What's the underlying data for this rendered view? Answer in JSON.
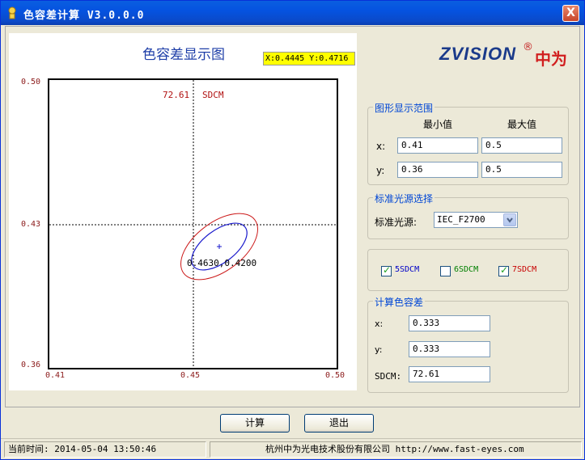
{
  "window": {
    "title": "色容差计算 V3.0.0.0",
    "close_glyph": "X"
  },
  "graph": {
    "title": "色容差显示图",
    "coord_readout": "X:0.4445 Y:0.4716",
    "sdcm_value_label": "72.61",
    "sdcm_unit_label": "SDCM",
    "center_label": "0.4630,0.4200",
    "y_ticks": [
      "0.50",
      "0.43",
      "0.36"
    ],
    "x_ticks": [
      "0.41",
      "0.45",
      "0.50"
    ]
  },
  "logo": {
    "text": "ZVISION",
    "registered": "®",
    "cn_text": "中为"
  },
  "range_group": {
    "title": "图形显示范围",
    "min_header": "最小值",
    "max_header": "最大值",
    "x_label": "x:",
    "y_label": "y:",
    "x_min": "0.41",
    "x_max": "0.5",
    "y_min": "0.36",
    "y_max": "0.5"
  },
  "light_group": {
    "title": "标准光源选择",
    "label": "标准光源:",
    "selected": "IEC_F2700"
  },
  "sdcm_checks": [
    {
      "label": "5SDCM",
      "checked": true,
      "color": "#0000c8"
    },
    {
      "label": "6SDCM",
      "checked": false,
      "color": "#008000"
    },
    {
      "label": "7SDCM",
      "checked": true,
      "color": "#c80000"
    }
  ],
  "calc_group": {
    "title": "计算色容差",
    "x_label": "x:",
    "y_label": "y:",
    "sdcm_label": "SDCM:",
    "x_value": "0.333",
    "y_value": "0.333",
    "sdcm_value": "72.61"
  },
  "buttons": {
    "calc": "计算",
    "exit": "退出"
  },
  "status": {
    "time": "当前时间: 2014-05-04 13:50:46",
    "company": "杭州中为光电技术股份有限公司 http://www.fast-eyes.com"
  }
}
